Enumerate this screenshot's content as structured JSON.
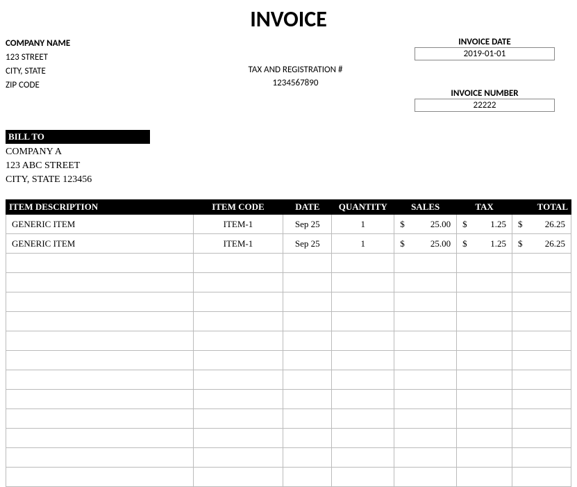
{
  "title": "INVOICE",
  "company": {
    "name": "COMPANY NAME",
    "street": "123 STREET",
    "city_state": "CITY, STATE",
    "zip": "ZIP CODE"
  },
  "tax_reg": {
    "label": "TAX AND REGISTRATION #",
    "value": "1234567890"
  },
  "invoice_date": {
    "label": "INVOICE DATE",
    "value": "2019-01-01"
  },
  "invoice_number": {
    "label": "INVOICE NUMBER",
    "value": "22222"
  },
  "bill_to": {
    "label": "BILL TO",
    "name": "COMPANY A",
    "street": "123 ABC STREET",
    "city_state_zip": "CITY, STATE 123456"
  },
  "columns": {
    "desc": "ITEM DESCRIPTION",
    "code": "ITEM CODE",
    "date": "DATE",
    "qty": "QUANTITY",
    "sales": "SALES",
    "tax": "TAX",
    "total": "TOTAL"
  },
  "currency": "$",
  "rows": [
    {
      "desc": "GENERIC ITEM",
      "code": "ITEM-1",
      "date": "Sep 25",
      "qty": "1",
      "sales": "25.00",
      "tax": "1.25",
      "total": "26.25"
    },
    {
      "desc": "GENERIC ITEM",
      "code": "ITEM-1",
      "date": "Sep 25",
      "qty": "1",
      "sales": "25.00",
      "tax": "1.25",
      "total": "26.25"
    }
  ],
  "empty_row_count": 12
}
